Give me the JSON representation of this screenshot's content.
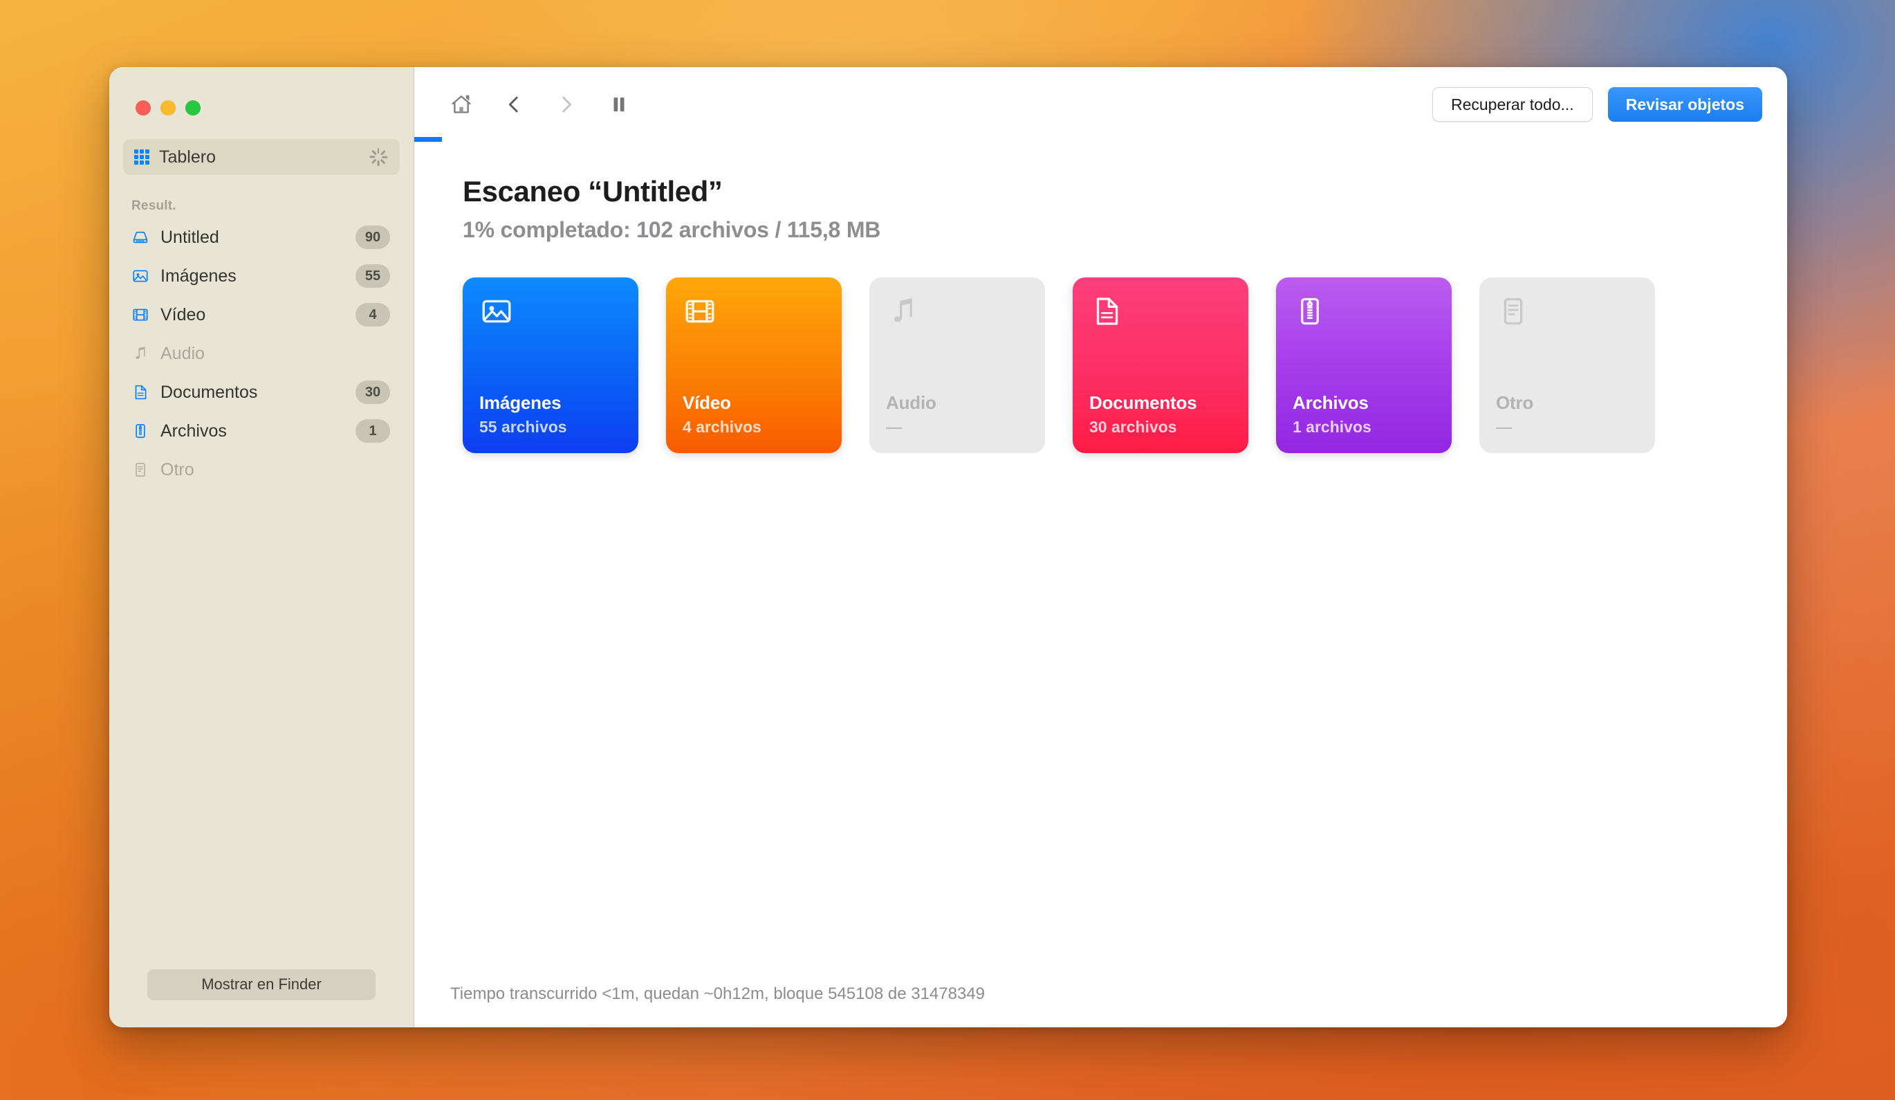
{
  "window": {
    "traffic_lights": [
      "close",
      "minimize",
      "maximize"
    ]
  },
  "sidebar": {
    "dashboard": {
      "label": "Tablero",
      "icon": "grid-icon",
      "busy": true,
      "busy_icon": "spinner-icon"
    },
    "section_label": "Result.",
    "items": [
      {
        "label": "Untitled",
        "badge": "90",
        "icon": "drive-icon",
        "enabled": true
      },
      {
        "label": "Imágenes",
        "badge": "55",
        "icon": "image-icon",
        "enabled": true
      },
      {
        "label": "Vídeo",
        "badge": "4",
        "icon": "film-icon",
        "enabled": true
      },
      {
        "label": "Audio",
        "badge": "",
        "icon": "music-icon",
        "enabled": false
      },
      {
        "label": "Documentos",
        "badge": "30",
        "icon": "document-icon",
        "enabled": true
      },
      {
        "label": "Archivos",
        "badge": "1",
        "icon": "archive-icon",
        "enabled": true
      },
      {
        "label": "Otro",
        "badge": "",
        "icon": "other-icon",
        "enabled": false
      }
    ],
    "footer_button": "Mostrar en Finder"
  },
  "toolbar": {
    "home_icon": "home-icon",
    "back_icon": "chevron-left-icon",
    "forward_icon": "chevron-right-icon",
    "pause_icon": "pause-icon",
    "recover_all_label": "Recuperar todo...",
    "review_objects_label": "Revisar objetos",
    "progress_percent": 1,
    "accent_color": "#1877f2"
  },
  "main": {
    "title": "Escaneo “Untitled”",
    "subtitle": "1% completado: 102 archivos / 115,8 MB",
    "cards": [
      {
        "title": "Imágenes",
        "count": "55 archivos",
        "icon": "image-icon",
        "enabled": true,
        "color": "#0a5cf5"
      },
      {
        "title": "Vídeo",
        "count": "4 archivos",
        "icon": "film-icon",
        "enabled": true,
        "color": "#fb7d03"
      },
      {
        "title": "Audio",
        "count": "—",
        "icon": "music-icon",
        "enabled": false,
        "color": "#e9e9e9"
      },
      {
        "title": "Documentos",
        "count": "30 archivos",
        "icon": "document-icon",
        "enabled": true,
        "color": "#fd2d62"
      },
      {
        "title": "Archivos",
        "count": "1 archivos",
        "icon": "archive-icon",
        "enabled": true,
        "color": "#a33bea"
      },
      {
        "title": "Otro",
        "count": "—",
        "icon": "other-icon",
        "enabled": false,
        "color": "#e9e9e9"
      }
    ]
  },
  "status": {
    "text": "Tiempo transcurrido <1m, quedan ~0h12m, bloque 545108 de 31478349"
  }
}
